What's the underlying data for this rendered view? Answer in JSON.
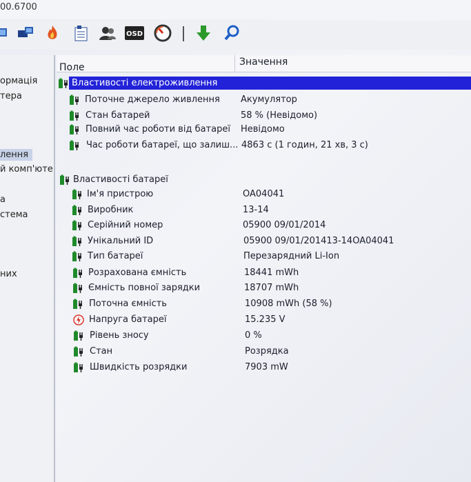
{
  "window": {
    "title": "00.6700"
  },
  "toolbar": {
    "icons": [
      "computer-icon",
      "network-icon",
      "flame-icon",
      "report-icon",
      "users-icon",
      "osd-icon",
      "gauge-icon",
      "download-icon",
      "search-icon"
    ],
    "osd_label": "OSD"
  },
  "sidebar": {
    "items": [
      {
        "label": "ормація"
      },
      {
        "label": "тера"
      },
      {
        "label": "лення",
        "selected": true
      },
      {
        "label": "й комп'юте"
      },
      {
        "label": "а"
      },
      {
        "label": "стема"
      },
      {
        "label": "них"
      }
    ]
  },
  "table": {
    "headers": {
      "field": "Поле",
      "value": "Значення"
    },
    "groups": [
      {
        "name": "Властивості електроживлення",
        "selected": true,
        "rows": [
          {
            "field": "Поточне джерело живлення",
            "value": "Акумулятор",
            "icon": "plug-icon"
          },
          {
            "field": "Стан батарей",
            "value": "58 % (Невідомо)",
            "icon": "plug-icon"
          },
          {
            "field": "Повний час роботи від батареї",
            "value": "Невідомо",
            "icon": "plug-icon"
          },
          {
            "field": "Час роботи батареї, що залиш...",
            "value": "4863 с (1 годин, 21 хв, 3 с)",
            "icon": "plug-icon"
          }
        ]
      },
      {
        "name": "Властивості батареї",
        "selected": false,
        "rows": [
          {
            "field": "Ім'я пристрою",
            "value": "OA04041",
            "icon": "plug-icon"
          },
          {
            "field": "Виробник",
            "value": "13-14",
            "icon": "plug-icon"
          },
          {
            "field": "Серійний номер",
            "value": "05900 09/01/2014",
            "icon": "plug-icon"
          },
          {
            "field": "Унікальний ID",
            "value": "05900 09/01/201413-14OA04041",
            "icon": "plug-icon"
          },
          {
            "field": "Тип батареї",
            "value": "Перезарядний Li-Ion",
            "icon": "plug-icon"
          },
          {
            "field": "Розрахована ємність",
            "value": "18441 mWh",
            "icon": "plug-icon"
          },
          {
            "field": "Ємність повної зарядки",
            "value": "18707 mWh",
            "icon": "plug-icon"
          },
          {
            "field": "Поточна ємність",
            "value": "10908 mWh  (58 %)",
            "icon": "plug-icon"
          },
          {
            "field": "Напруга батареї",
            "value": "15.235 V",
            "icon": "voltage-icon"
          },
          {
            "field": "Рівень зносу",
            "value": "0 %",
            "icon": "plug-icon"
          },
          {
            "field": "Стан",
            "value": "Розрядка",
            "icon": "plug-icon"
          },
          {
            "field": "Швидкість розрядки",
            "value": "7903 mW",
            "icon": "plug-icon"
          }
        ]
      }
    ]
  },
  "colors": {
    "selection": "#2222d8",
    "battery_green": "#1f8a2a"
  }
}
